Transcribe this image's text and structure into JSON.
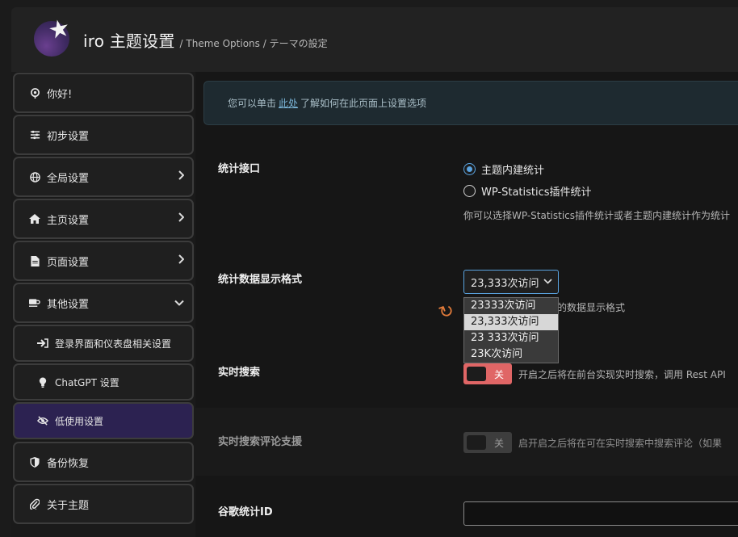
{
  "header": {
    "brand": "iro 主题设置",
    "subtitle": "/ Theme Options / テーマの設定"
  },
  "sidebar": {
    "items": [
      {
        "label": "你好!",
        "icon": "pin-icon"
      },
      {
        "label": "初步设置",
        "icon": "sliders-icon"
      },
      {
        "label": "全局设置",
        "icon": "globe-icon"
      },
      {
        "label": "主页设置",
        "icon": "home-icon"
      },
      {
        "label": "页面设置",
        "icon": "file-icon"
      },
      {
        "label": "其他设置",
        "icon": "coffee-icon"
      }
    ],
    "sub_items": [
      {
        "label": "登录界面和仪表盘相关设置",
        "icon": "login-icon"
      },
      {
        "label": "ChatGPT 设置",
        "icon": "lightbulb-icon"
      },
      {
        "label": "低使用设置",
        "icon": "eye-slash-icon"
      }
    ],
    "bottom_items": [
      {
        "label": "备份恢复",
        "icon": "shield-icon"
      },
      {
        "label": "关于主题",
        "icon": "paperclip-icon"
      }
    ]
  },
  "notice": {
    "prefix": "您可以单击",
    "link": "此处",
    "suffix": "了解如何在此页面上设置选项"
  },
  "stats_api": {
    "label": "统计接口",
    "options": [
      "主题内建统计",
      "WP-Statistics插件统计"
    ],
    "selected": "主题内建统计",
    "desc": "你可以选择WP-Statistics插件统计或者主题内建统计作为统计"
  },
  "stats_format": {
    "label": "统计数据显示格式",
    "value": "23,333次访问",
    "desc_tail": "的数据显示格式",
    "options": [
      "23333次访问",
      "23,333次访问",
      "23 333次访问",
      "23K次访问"
    ],
    "highlighted": "23,333次访问"
  },
  "live_search": {
    "label": "实时搜索",
    "toggle_label": "关",
    "desc": "开启之后将在前台实现实时搜索，调用 Rest API"
  },
  "live_search_comments": {
    "label": "实时搜索评论支援",
    "toggle_label": "关",
    "desc": "启开启之后将在可在实时搜索中搜索评论（如果"
  },
  "ga_id": {
    "label": "谷歌统计ID",
    "value": ""
  },
  "colors": {
    "accent": "#5aa3e0",
    "toggle_on": "#e06666",
    "active_nav": "#2c2251"
  }
}
